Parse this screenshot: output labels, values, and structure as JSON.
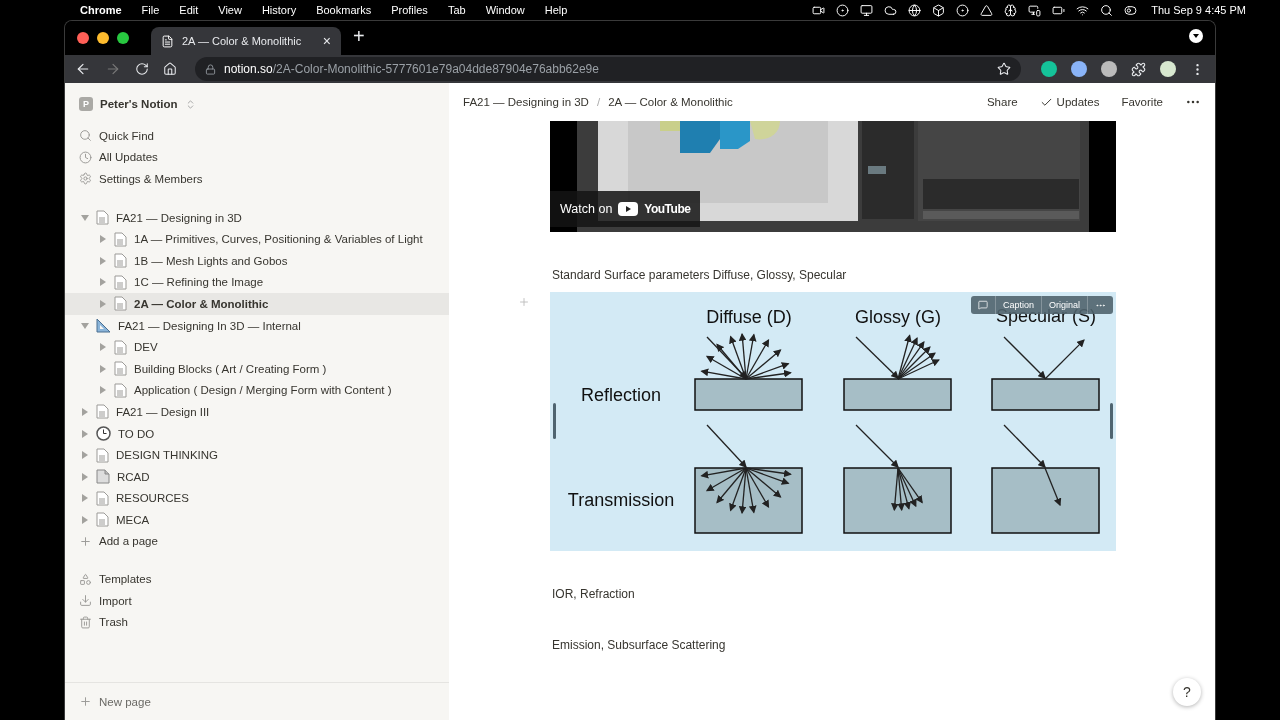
{
  "menu_bar": {
    "app": "Chrome",
    "menus": [
      "File",
      "Edit",
      "View",
      "History",
      "Bookmarks",
      "Profiles",
      "Tab",
      "Window",
      "Help"
    ],
    "clock": "Thu Sep 9  4:45 PM"
  },
  "browser": {
    "tab": {
      "title": "2A — Color & Monolithic",
      "close": "×"
    },
    "new_tab": "+",
    "url": {
      "host": "notion.so",
      "path": "/2A-Color-Monolithic-5777601e79a04dde87904e76abb62e9e"
    }
  },
  "sidebar": {
    "workspace": {
      "initial": "P",
      "name": "Peter's Notion"
    },
    "actions": [
      "Quick Find",
      "All Updates",
      "Settings & Members"
    ],
    "pages": [
      {
        "label": "FA21 — Designing in 3D",
        "kind": "page",
        "expanded": true,
        "selected": false,
        "children": [
          {
            "label": "1A — Primitives, Curves, Positioning & Variables of Light",
            "kind": "page",
            "expanded": false,
            "selected": false
          },
          {
            "label": "1B — Mesh Lights and Gobos",
            "kind": "page",
            "expanded": false,
            "selected": false
          },
          {
            "label": "1C — Refining the Image",
            "kind": "page",
            "expanded": false,
            "selected": false
          },
          {
            "label": "2A — Color & Monolithic",
            "kind": "page",
            "expanded": false,
            "selected": true
          }
        ]
      },
      {
        "label": "FA21 — Designing In 3D — Internal",
        "kind": "ruler",
        "expanded": true,
        "selected": false,
        "children": [
          {
            "label": "DEV",
            "kind": "page",
            "expanded": false,
            "selected": false
          },
          {
            "label": "Building Blocks ( Art / Creating Form )",
            "kind": "page",
            "expanded": false,
            "selected": false
          },
          {
            "label": "Application ( Design / Merging Form with Content )",
            "kind": "page",
            "expanded": false,
            "selected": false
          }
        ]
      },
      {
        "label": "FA21 — Design III",
        "kind": "page",
        "expanded": false,
        "selected": false
      },
      {
        "label": "TO DO",
        "kind": "clock",
        "expanded": false,
        "selected": false
      },
      {
        "label": "DESIGN THINKING",
        "kind": "page",
        "expanded": false,
        "selected": false
      },
      {
        "label": "RCAD",
        "kind": "file",
        "expanded": false,
        "selected": false
      },
      {
        "label": "RESOURCES",
        "kind": "page",
        "expanded": false,
        "selected": false
      },
      {
        "label": "MECA",
        "kind": "page",
        "expanded": false,
        "selected": false
      }
    ],
    "add_page": "Add a page",
    "tools": [
      "Templates",
      "Import",
      "Trash"
    ],
    "new_page": "New page"
  },
  "topbar": {
    "breadcrumb": [
      "FA21 — Designing in 3D",
      "2A — Color & Monolithic"
    ],
    "separator": "/",
    "actions": [
      "Share",
      "Updates",
      "Favorite"
    ]
  },
  "video": {
    "kind": "picture",
    "watch_label": "Watch on",
    "logo_text": "YouTube"
  },
  "blocks": [
    {
      "kind": "text",
      "text": "Standard Surface parameters Diffuse, Glossy, Specular"
    },
    {
      "kind": "diagram",
      "columns": [
        "Diffuse (D)",
        "Glossy (G)",
        "Specular (S)"
      ],
      "rows": [
        "Reflection",
        "Transmission"
      ],
      "toolbar": [
        "Caption",
        "Original"
      ]
    },
    {
      "kind": "text",
      "text": "IOR, Refraction"
    },
    {
      "kind": "text",
      "text": "Emission, Subsurface Scattering"
    }
  ],
  "help": "?"
}
